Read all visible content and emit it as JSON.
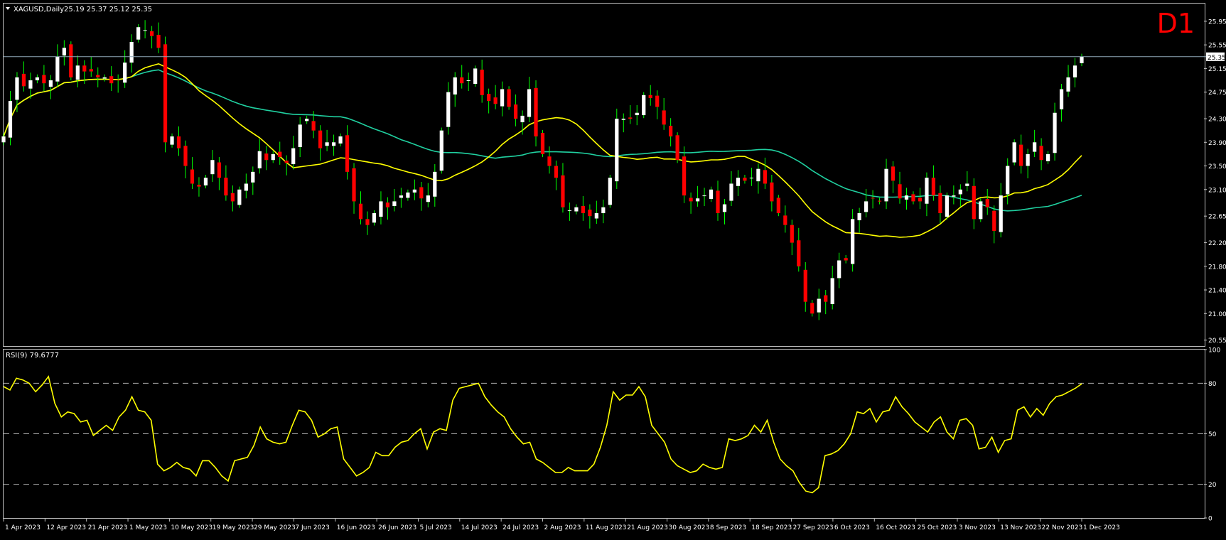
{
  "header": {
    "symbol": "XAGUSD,Daily",
    "ohlc": "25.19 25.37 25.12 25.35",
    "timeframe_badge": "D1"
  },
  "price_axis": {
    "ticks": [
      "25.95",
      "25.55",
      "25.15",
      "24.75",
      "24.30",
      "23.90",
      "23.50",
      "23.10",
      "22.65",
      "22.20",
      "21.80",
      "21.40",
      "21.00",
      "20.55"
    ],
    "current_price_label": "25.35"
  },
  "rsi_panel": {
    "title": "RSI(9) 79.6777",
    "ticks": [
      "100",
      "80",
      "50",
      "20",
      "0"
    ],
    "levels": [
      80,
      50,
      20
    ]
  },
  "date_axis": {
    "labels": [
      "1 Apr 2023",
      "12 Apr 2023",
      "21 Apr 2023",
      "1 May 2023",
      "10 May 2023",
      "19 May 2023",
      "29 May 2023",
      "7 Jun 2023",
      "16 Jun 2023",
      "26 Jun 2023",
      "5 Jul 2023",
      "14 Jul 2023",
      "24 Jul 2023",
      "2 Aug 2023",
      "11 Aug 2023",
      "21 Aug 2023",
      "30 Aug 2023",
      "8 Sep 2023",
      "18 Sep 2023",
      "27 Sep 2023",
      "6 Oct 2023",
      "16 Oct 2023",
      "25 Oct 2023",
      "3 Nov 2023",
      "13 Nov 2023",
      "22 Nov 2023",
      "1 Dec 2023"
    ]
  },
  "colors": {
    "background": "#000000",
    "frame": "#c0c0c0",
    "up_candle": "#ffffff",
    "down_candle": "#ff0000",
    "wick": "#00ff00",
    "fast_ma": "#ffff00",
    "slow_ma": "#20d0a0",
    "rsi_line": "#ffff00",
    "price_line": "#8fa8b8",
    "badge": "#ff0000",
    "text": "#ffffff"
  },
  "chart_data": [
    {
      "type": "candlestick",
      "title": "XAGUSD,Daily",
      "ylim": [
        20.45,
        26.25
      ],
      "close_series": [
        24.0,
        24.6,
        25.0,
        24.85,
        24.95,
        25.0,
        24.9,
        24.95,
        25.35,
        25.5,
        25.0,
        25.2,
        25.1,
        25.1,
        25.0,
        25.0,
        24.9,
        24.95,
        25.25,
        25.6,
        25.85,
        25.8,
        25.7,
        25.5,
        23.9,
        24.0,
        23.8,
        23.5,
        23.2,
        23.15,
        23.3,
        23.6,
        23.3,
        23.0,
        22.9,
        23.1,
        23.2,
        23.4,
        23.75,
        23.6,
        23.7,
        23.65,
        23.55,
        23.8,
        24.2,
        24.3,
        24.1,
        23.8,
        23.9,
        23.9,
        24.0,
        23.4,
        22.9,
        22.6,
        22.5,
        22.7,
        22.9,
        22.8,
        22.9,
        23.0,
        23.05,
        23.1,
        22.95,
        23.0,
        23.4,
        24.1,
        24.75,
        25.0,
        24.9,
        24.95,
        25.15,
        24.7,
        24.6,
        24.55,
        24.8,
        24.5,
        24.3,
        24.35,
        24.8,
        24.0,
        23.7,
        23.5,
        23.3,
        22.8,
        22.75,
        22.8,
        22.7,
        22.65,
        22.7,
        22.8,
        23.3,
        24.3,
        24.3,
        24.3,
        24.4,
        24.7,
        24.65,
        24.5,
        24.2,
        24.0,
        23.6,
        23.0,
        22.9,
        22.95,
        23.0,
        23.1,
        22.7,
        22.85,
        23.2,
        23.3,
        23.25,
        23.3,
        23.45,
        23.2,
        22.9,
        22.7,
        22.5,
        22.2,
        21.8,
        21.2,
        21.0,
        21.25,
        21.2,
        21.6,
        21.9,
        21.9,
        22.6,
        22.7,
        22.9,
        22.95,
        22.9,
        23.45,
        23.25,
        22.95,
        23.0,
        22.9,
        22.9,
        23.3,
        23.0,
        22.7,
        23.0,
        23.0,
        23.1,
        23.2,
        22.6,
        22.9,
        22.8,
        22.4,
        23.0,
        23.5,
        23.9,
        23.5,
        23.7,
        23.9,
        23.6,
        23.7,
        24.4,
        24.8,
        25.0,
        25.2,
        25.35
      ],
      "fast_ma_period": 20,
      "slow_ma_period": 50,
      "last_close": 25.35
    },
    {
      "type": "line",
      "title": "RSI(9) 79.6777",
      "ylim": [
        0,
        100
      ],
      "series": [
        {
          "values": [
            78,
            76,
            83,
            82,
            80,
            75,
            79,
            84,
            68,
            60,
            63,
            62,
            57,
            58,
            49,
            52,
            55,
            52,
            60,
            64,
            72,
            64,
            63,
            58,
            32,
            28,
            30,
            33,
            30,
            29,
            25,
            34,
            34,
            30,
            25,
            22,
            34,
            35,
            36,
            43,
            54,
            47,
            45,
            44,
            45,
            55,
            64,
            63,
            58,
            48,
            50,
            53,
            54,
            35,
            30,
            25,
            27,
            30,
            39,
            37,
            37,
            42,
            45,
            46,
            50,
            53,
            41,
            51,
            53,
            52,
            70,
            77,
            78,
            79,
            80,
            72,
            67,
            63,
            60,
            53,
            48,
            44,
            45,
            35,
            33,
            30,
            27,
            27,
            30,
            28,
            28,
            28,
            32,
            42,
            55,
            75,
            70,
            73,
            73,
            78,
            72,
            55,
            50,
            45,
            35,
            31,
            29,
            27,
            28,
            32,
            30,
            29,
            30,
            47,
            46,
            47,
            49,
            55,
            51,
            58,
            45,
            35,
            31,
            28,
            21,
            16,
            15,
            18,
            37,
            38,
            40,
            44,
            50,
            63,
            62,
            65,
            57,
            63,
            64,
            72,
            66,
            62,
            57,
            54,
            51,
            57,
            60,
            51,
            47,
            58,
            59,
            55,
            41,
            42,
            48,
            39,
            46,
            47,
            64,
            66,
            60,
            65,
            61,
            68,
            72,
            73,
            75,
            77,
            79.68
          ]
        }
      ]
    }
  ]
}
